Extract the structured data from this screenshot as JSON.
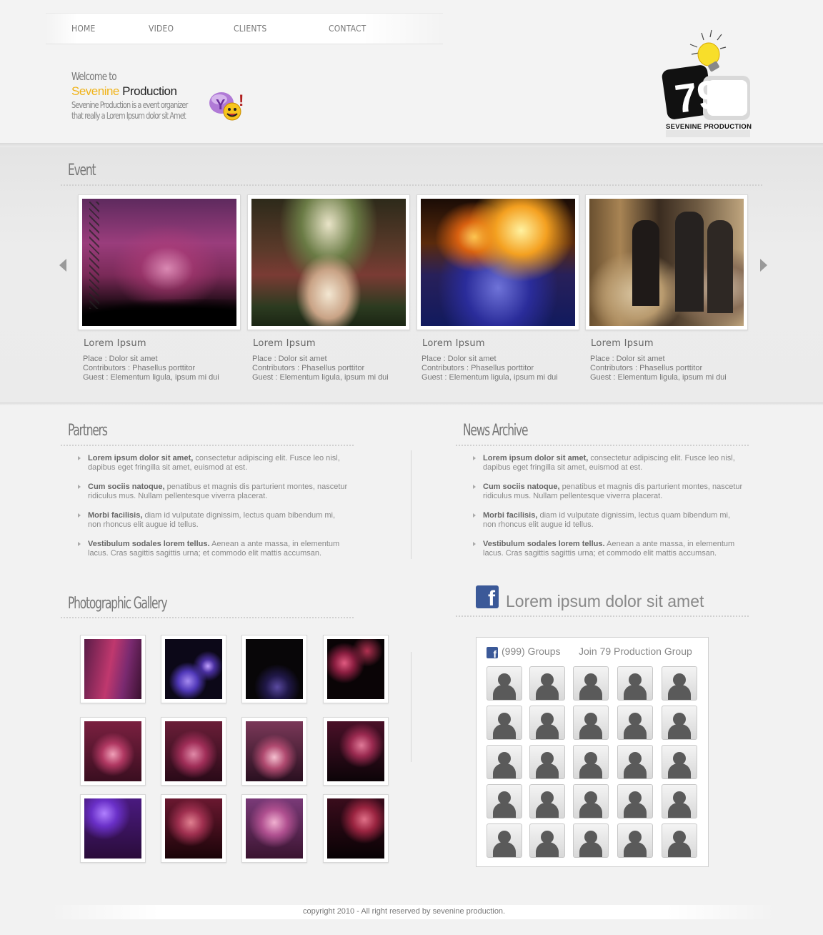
{
  "nav": {
    "items": [
      {
        "label": "HOME"
      },
      {
        "label": "VIDEO"
      },
      {
        "label": "CLIENTS"
      },
      {
        "label": "CONTACT"
      }
    ]
  },
  "welcome": {
    "line1": "Welcome to",
    "brand_first": "Sevenine",
    "brand_second": "Production",
    "description": "Sevenine Production is a event organizer that really a Lorem Ipsum dolor sit Amet"
  },
  "logo": {
    "text": "SEVENINE PRODUCTION",
    "digits": "79"
  },
  "colors": {
    "accent_yellow": "#f0b31a",
    "facebook_blue": "#3b5998"
  },
  "event": {
    "title": "Event",
    "cards": [
      {
        "name": "Lorem Ipsum",
        "place": "Place : Dolor sit amet",
        "contributors": "Contributors : Phasellus porttitor",
        "guest": "Guest : Elementum ligula, ipsum mi dui"
      },
      {
        "name": "Lorem Ipsum",
        "place": "Place : Dolor sit amet",
        "contributors": "Contributors : Phasellus porttitor",
        "guest": "Guest : Elementum ligula, ipsum mi dui"
      },
      {
        "name": "Lorem Ipsum",
        "place": "Place : Dolor sit amet",
        "contributors": "Contributors : Phasellus porttitor",
        "guest": "Guest : Elementum ligula, ipsum mi dui"
      },
      {
        "name": "Lorem Ipsum",
        "place": "Place : Dolor sit amet",
        "contributors": "Contributors : Phasellus porttitor",
        "guest": "Guest : Elementum ligula, ipsum mi dui"
      }
    ]
  },
  "partners": {
    "title": "Partners",
    "items": [
      {
        "bold": "Lorem ipsum dolor sit amet,",
        "text": " consectetur adipiscing elit. Fusce leo nisl, dapibus eget fringilla sit amet, euismod at est."
      },
      {
        "bold": "Cum sociis natoque,",
        "text": " penatibus et magnis dis parturient montes, nascetur ridiculus mus. Nullam pellentesque viverra placerat."
      },
      {
        "bold": "Morbi facilisis,",
        "text": " diam id vulputate dignissim, lectus quam bibendum mi, non rhoncus elit augue id tellus."
      },
      {
        "bold": "Vestibulum sodales lorem tellus.",
        "text": " Aenean a ante massa, in elementum lacus. Cras sagittis sagittis urna; et commodo elit mattis accumsan."
      }
    ]
  },
  "news": {
    "title": "News Archive",
    "items": [
      {
        "bold": "Lorem ipsum dolor sit amet,",
        "text": " consectetur adipiscing elit. Fusce leo nisl, dapibus eget fringilla sit amet, euismod at est."
      },
      {
        "bold": "Cum sociis natoque,",
        "text": " penatibus et magnis dis parturient montes, nascetur ridiculus mus. Nullam pellentesque viverra placerat."
      },
      {
        "bold": "Morbi facilisis,",
        "text": " diam id vulputate dignissim, lectus quam bibendum mi, non rhoncus elit augue id tellus."
      },
      {
        "bold": "Vestibulum sodales lorem tellus.",
        "text": " Aenean a ante massa, in elementum lacus. Cras sagittis sagittis urna; et commodo elit mattis accumsan."
      }
    ]
  },
  "gallery": {
    "title": "Photographic Gallery"
  },
  "facebook": {
    "title": "Lorem ipsum dolor sit amet",
    "groups": "(999) Groups",
    "join": "Join 79 Production Group",
    "icon": "f"
  },
  "footer": {
    "copyright": "copyright 2010 - All right reserved by sevenine production."
  }
}
